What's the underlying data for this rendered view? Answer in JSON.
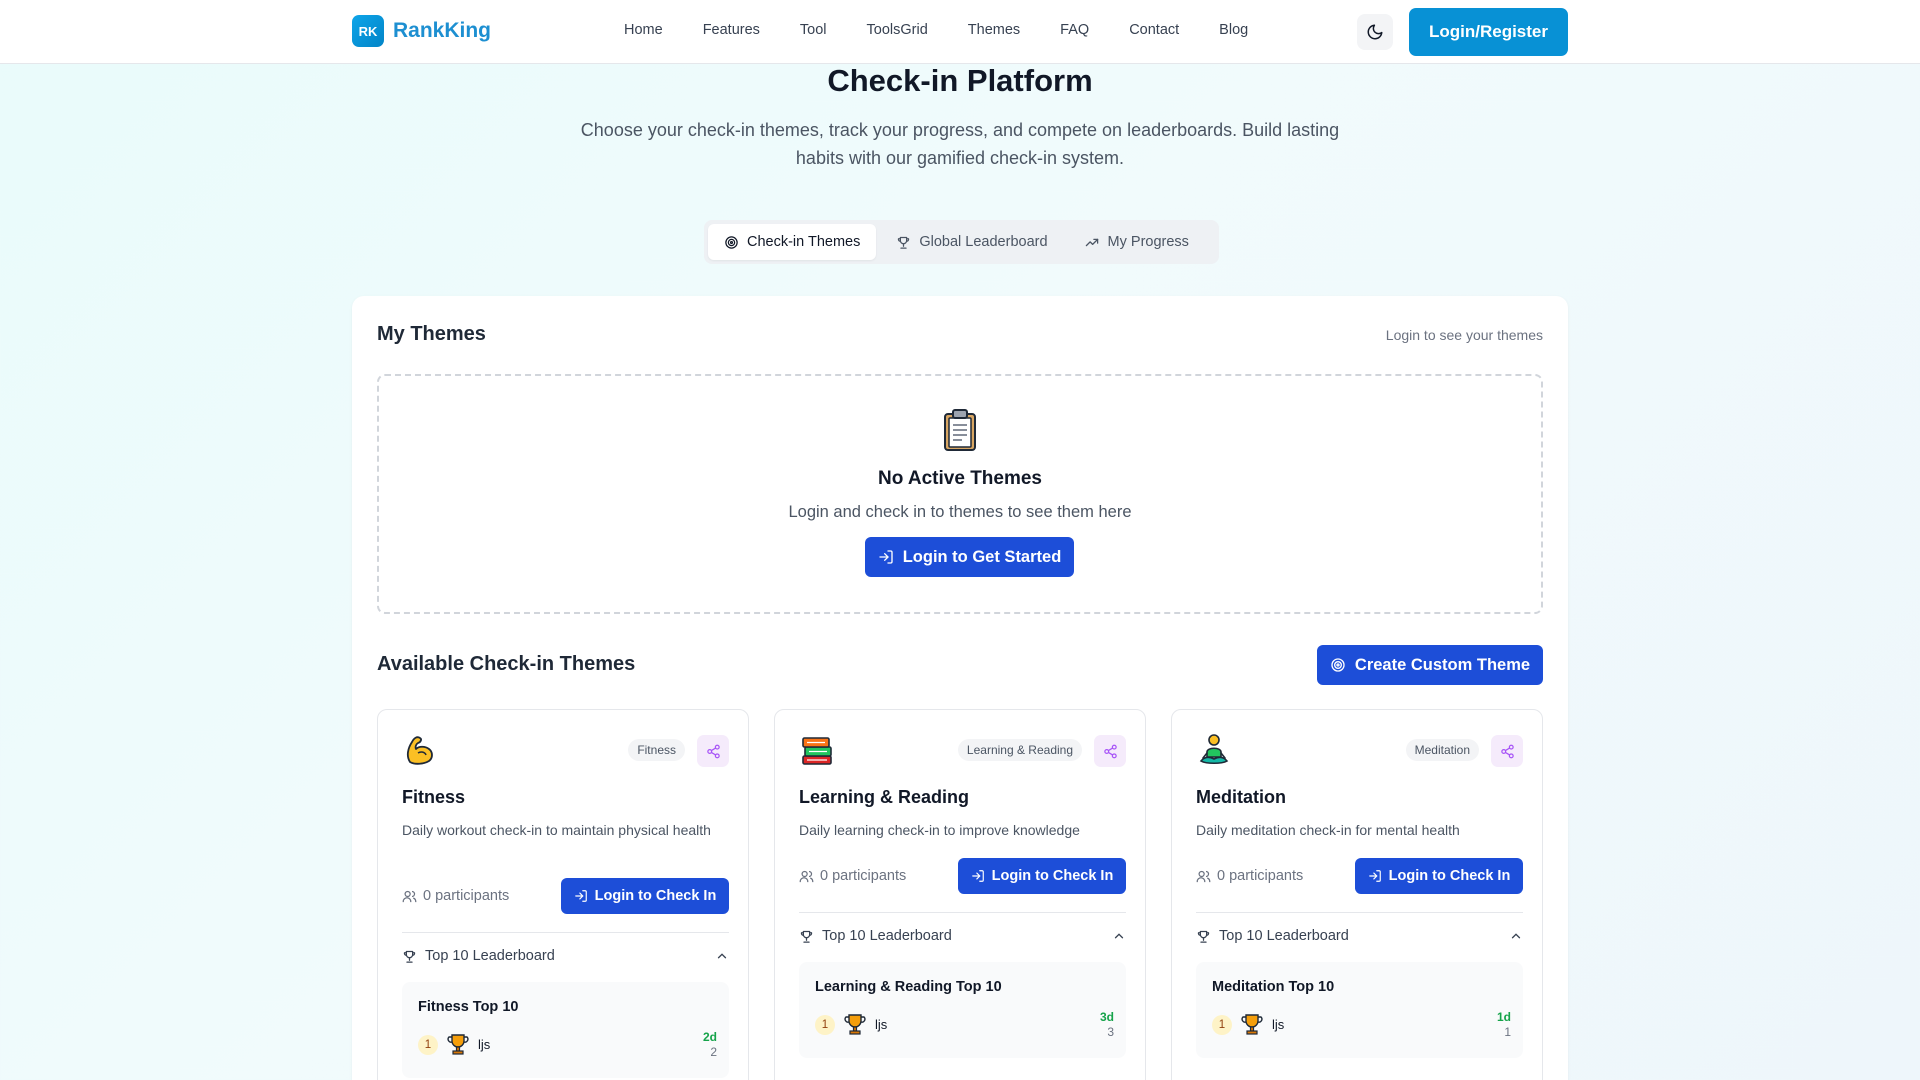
{
  "header": {
    "logo_badge": "RK",
    "logo_text": "RankKing",
    "nav": [
      "Home",
      "Features",
      "Tool",
      "ToolsGrid",
      "Themes",
      "FAQ",
      "Contact",
      "Blog"
    ],
    "theme_toggle_icon": "moon-icon",
    "login_label": "Login/Register"
  },
  "hero": {
    "title": "Check-in Platform",
    "subtitle": "Choose your check-in themes, track your progress, and compete on leaderboards. Build lasting habits with our gamified check-in system."
  },
  "tabs": [
    {
      "label": "Check-in Themes",
      "icon": "target-icon",
      "active": true
    },
    {
      "label": "Global Leaderboard",
      "icon": "trophy-icon",
      "active": false
    },
    {
      "label": "My Progress",
      "icon": "trending-up-icon",
      "active": false
    }
  ],
  "my_themes": {
    "title": "My Themes",
    "hint": "Login to see your themes",
    "empty_icon": "clipboard-icon",
    "empty_title": "No Active Themes",
    "empty_text": "Login and check in to themes to see them here",
    "empty_button": "Login to Get Started"
  },
  "available": {
    "title": "Available Check-in Themes",
    "create_button": "Create Custom Theme"
  },
  "cards": [
    {
      "emoji": "flexed-biceps-icon",
      "category": "Fitness",
      "title": "Fitness",
      "description": "Daily workout check-in to maintain physical health",
      "participants": "0 participants",
      "button": "Login to Check In",
      "leaderboard_label": "Top 10 Leaderboard",
      "leaderboard_title": "Fitness Top 10",
      "entry": {
        "rank": "1",
        "user": "ljs",
        "days": "2d",
        "count": "2"
      }
    },
    {
      "emoji": "books-icon",
      "category": "Learning & Reading",
      "title": "Learning & Reading",
      "description": "Daily learning check-in to improve knowledge",
      "participants": "0 participants",
      "button": "Login to Check In",
      "leaderboard_label": "Top 10 Leaderboard",
      "leaderboard_title": "Learning & Reading Top 10",
      "entry": {
        "rank": "1",
        "user": "ljs",
        "days": "3d",
        "count": "3"
      }
    },
    {
      "emoji": "meditation-icon",
      "category": "Meditation",
      "title": "Meditation",
      "description": "Daily meditation check-in for mental health",
      "participants": "0 participants",
      "button": "Login to Check In",
      "leaderboard_label": "Top 10 Leaderboard",
      "leaderboard_title": "Meditation Top 10",
      "entry": {
        "rank": "1",
        "user": "ljs",
        "days": "1d",
        "count": "1"
      }
    }
  ],
  "colors": {
    "primary": "#1d4ed8",
    "header_button": "#0891d5",
    "logo": "#1d8fd1",
    "streak_green": "#16a34a",
    "share_bg": "#f5ebfb",
    "share_icon": "#a855f7"
  }
}
